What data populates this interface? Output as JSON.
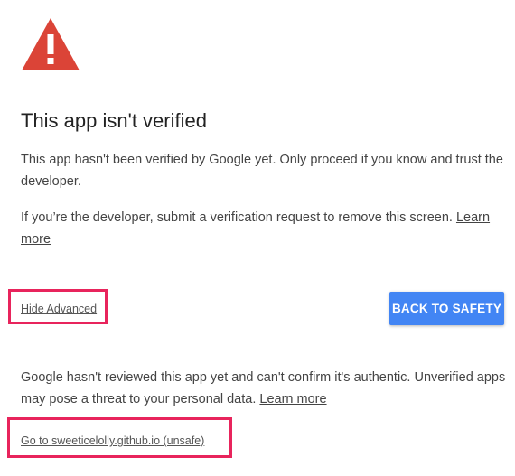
{
  "icon": {
    "name": "warning-icon",
    "color": "#db4437"
  },
  "title": "This app isn't verified",
  "paragraph1": "This app hasn't been verified by Google yet. Only proceed if you know and trust the developer.",
  "paragraph2": {
    "text": "If you’re the developer, submit a verification request to remove this screen. ",
    "link": "Learn more"
  },
  "advanced": {
    "label": "Hide Advanced",
    "highlight_color": "#e8245c"
  },
  "back_button": {
    "label": "BACK TO SAFETY",
    "color": "#4285f4"
  },
  "paragraph3": {
    "text": "Google hasn't reviewed this app yet and can't confirm it's authentic. Unverified apps may pose a threat to your personal data. ",
    "link": "Learn more"
  },
  "unsafe_link": {
    "label": "Go to sweeticelolly.github.io (unsafe)",
    "highlight_color": "#e8245c"
  }
}
